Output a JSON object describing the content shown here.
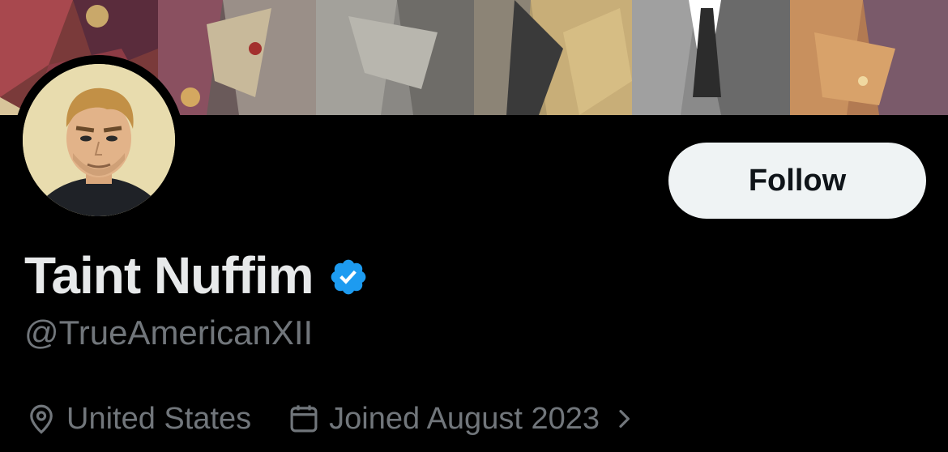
{
  "profile": {
    "display_name": "Taint Nuffim",
    "handle": "@TrueAmericanXII",
    "location": "United States",
    "joined": "Joined August 2023"
  },
  "actions": {
    "follow_label": "Follow"
  },
  "icons": {
    "verified": "verified-badge-icon",
    "location": "location-pin-icon",
    "calendar": "calendar-icon",
    "chevron": "chevron-right-icon"
  },
  "colors": {
    "background": "#000000",
    "verified_blue": "#1d9bf0",
    "muted_text": "#71767b",
    "follow_bg": "#eff3f4"
  }
}
